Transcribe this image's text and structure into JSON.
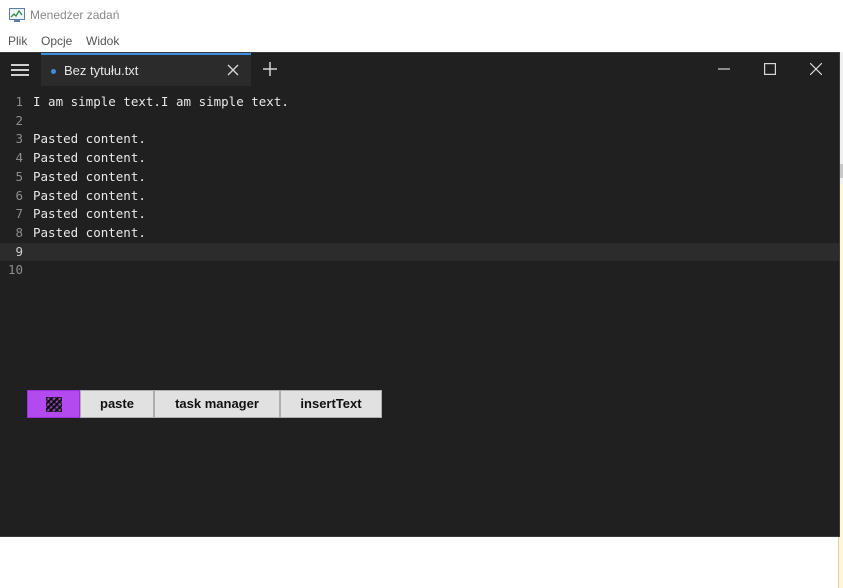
{
  "background_app": {
    "title": "Menedżer zadań",
    "icon": "task-manager-icon",
    "menu": [
      "Plik",
      "Opcje",
      "Widok"
    ]
  },
  "editor": {
    "menu_icon": "hamburger-menu-icon",
    "tab": {
      "title": "Bez tytułu.txt",
      "modified_indicator_color": "#3b8de0"
    },
    "window_controls": [
      "minimize-icon",
      "maximize-icon",
      "close-icon"
    ],
    "lines": [
      {
        "n": "1",
        "text": "I am simple text.I am simple text."
      },
      {
        "n": "2",
        "text": ""
      },
      {
        "n": "3",
        "text": "Pasted content."
      },
      {
        "n": "4",
        "text": "Pasted content."
      },
      {
        "n": "5",
        "text": "Pasted content."
      },
      {
        "n": "6",
        "text": "Pasted content."
      },
      {
        "n": "7",
        "text": "Pasted content."
      },
      {
        "n": "8",
        "text": "Pasted content."
      },
      {
        "n": "9",
        "text": ""
      },
      {
        "n": "10",
        "text": ""
      }
    ],
    "current_line": "9"
  },
  "toolbar": {
    "swatch_color": "#b34af0",
    "buttons": {
      "paste": "paste",
      "task_manager": "task manager",
      "insert_text": "insertText"
    }
  }
}
